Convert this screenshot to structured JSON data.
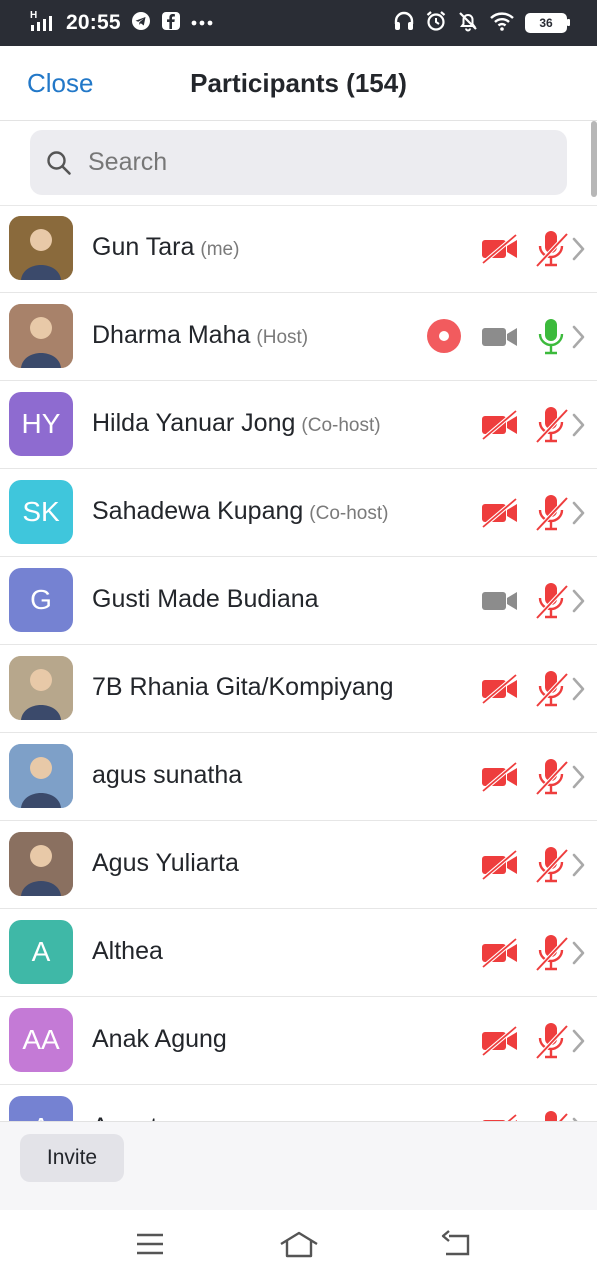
{
  "status_bar": {
    "network": "H",
    "time": "20:55",
    "battery": "36"
  },
  "header": {
    "close_label": "Close",
    "title": "Participants (154)"
  },
  "search": {
    "placeholder": "Search"
  },
  "participants": [
    {
      "name": "Gun Tara",
      "role": "(me)",
      "avatar_initials": "",
      "avatar_color": "#8a6a3c",
      "video": "off",
      "audio": "muted",
      "recording": false
    },
    {
      "name": "Dharma Maha",
      "role": "(Host)",
      "avatar_initials": "",
      "avatar_color": "#a8826a",
      "video": "on",
      "audio": "active",
      "recording": true
    },
    {
      "name": "Hilda Yanuar Jong",
      "role": "(Co-host)",
      "avatar_initials": "HY",
      "avatar_color": "#8e6bd0",
      "video": "off",
      "audio": "muted",
      "recording": false
    },
    {
      "name": "Sahadewa Kupang",
      "role": "(Co-host)",
      "avatar_initials": "SK",
      "avatar_color": "#3fc6dc",
      "video": "off",
      "audio": "muted",
      "recording": false
    },
    {
      "name": " Gusti Made Budiana",
      "role": "",
      "avatar_initials": "G",
      "avatar_color": "#7582d2",
      "video": "on",
      "audio": "muted",
      "recording": false
    },
    {
      "name": "7B Rhania Gita/Kompiyang",
      "role": "",
      "avatar_initials": "",
      "avatar_color": "#b7a78c",
      "video": "off",
      "audio": "muted",
      "recording": false
    },
    {
      "name": "agus sunatha",
      "role": "",
      "avatar_initials": "",
      "avatar_color": "#7ea0c8",
      "video": "off",
      "audio": "muted",
      "recording": false
    },
    {
      "name": "Agus Yuliarta",
      "role": "",
      "avatar_initials": "",
      "avatar_color": "#8a7060",
      "video": "off",
      "audio": "muted",
      "recording": false
    },
    {
      "name": "Althea",
      "role": "",
      "avatar_initials": "A",
      "avatar_color": "#3fb8a7",
      "video": "off",
      "audio": "muted",
      "recording": false
    },
    {
      "name": "Anak Agung",
      "role": "",
      "avatar_initials": "AA",
      "avatar_color": "#c47ad6",
      "video": "off",
      "audio": "muted",
      "recording": false
    },
    {
      "name": "Ananta",
      "role": "",
      "avatar_initials": "A",
      "avatar_color": "#7582d2",
      "video": "off",
      "audio": "muted",
      "recording": false
    }
  ],
  "footer": {
    "invite_label": "Invite"
  },
  "colors": {
    "accent": "#2278c8",
    "muted_red": "#ee3d3d",
    "active_green": "#3cba3c",
    "inactive_gray": "#8c8c8c"
  }
}
